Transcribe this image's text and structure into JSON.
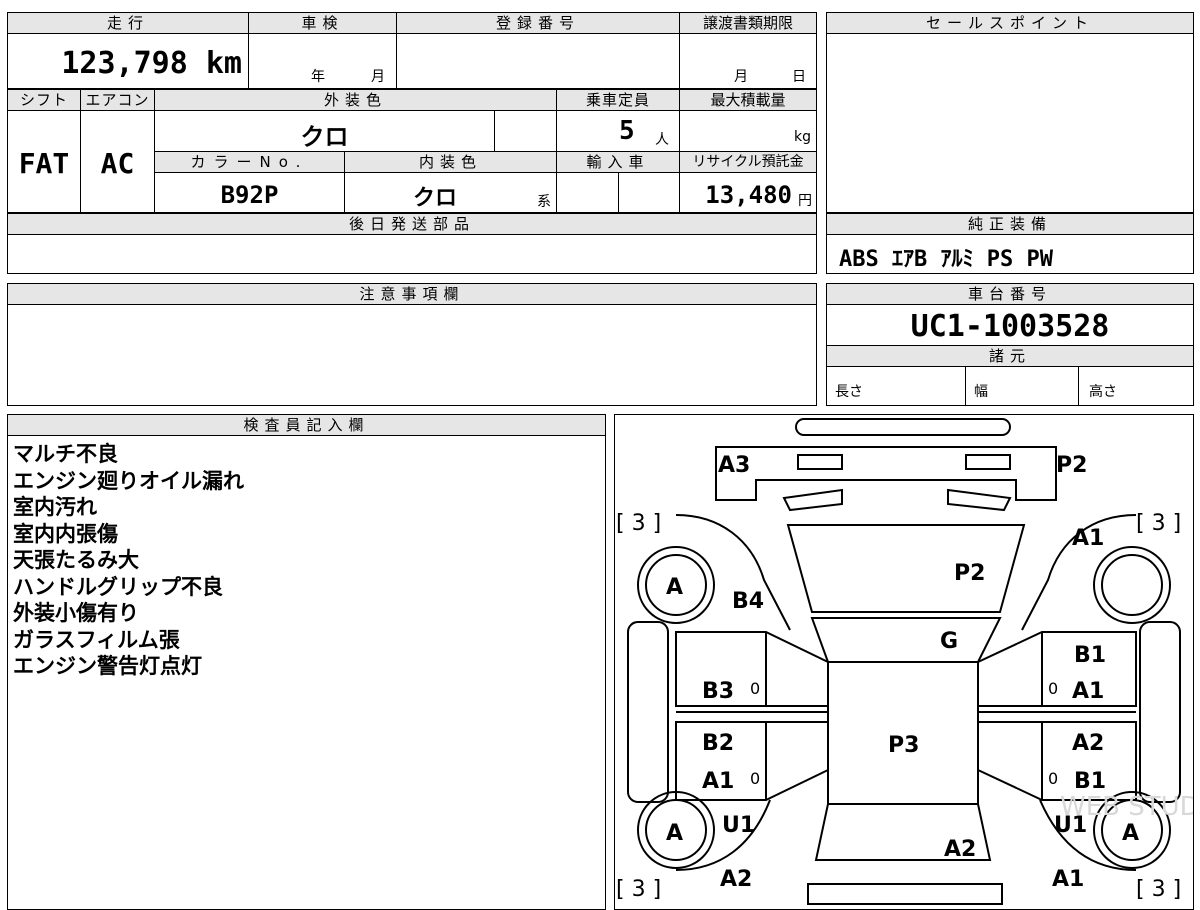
{
  "top": {
    "mileage_label": "走行",
    "mileage_value": "123,798 km",
    "inspection_label": "車検",
    "inspection_year": "年",
    "inspection_month": "月",
    "registration_label": "登録番号",
    "registration_value": "",
    "transfer_label": "譲渡書類期限",
    "transfer_month": "月",
    "transfer_day": "日",
    "shift_label": "シフト",
    "shift_value": "FAT",
    "ac_label": "エアコン",
    "ac_value": "AC",
    "exterior_label": "外装色",
    "exterior_value": "クロ",
    "capacity_label": "乗車定員",
    "capacity_value": "5",
    "capacity_unit": "人",
    "load_label": "最大積載量",
    "load_unit": "kg",
    "color_no_label": "カラーNo.",
    "color_no_value": "B92P",
    "interior_label": "内装色",
    "interior_value": "クロ",
    "interior_suffix": "系",
    "import_label": "輸入車",
    "recycle_label": "リサイクル預託金",
    "recycle_value": "13,480",
    "recycle_unit": "円",
    "later_parts_label": "後日発送部品",
    "later_parts_value": ""
  },
  "right": {
    "sales_point_label": "セールスポイント",
    "sales_point_value": "",
    "equipment_label": "純正装備",
    "equipment_value": "ABS ｴｱB ｱﾙﾐ PS PW",
    "chassis_label": "車台番号",
    "chassis_value": "UC1-1003528",
    "specs_label": "諸元",
    "length_label": "長さ",
    "width_label": "幅",
    "height_label": "高さ"
  },
  "notes": {
    "label": "注意事項欄",
    "value": ""
  },
  "inspector": {
    "label": "検査員記入欄",
    "remarks": [
      "マルチ不良",
      "エンジン廻りオイル漏れ",
      "室内汚れ",
      "室内内張傷",
      "天張たるみ大",
      "ハンドルグリップ不良",
      "外装小傷有り",
      "ガラスフィルム張",
      "エンジン警告灯点灯"
    ]
  },
  "diagram": {
    "marks": {
      "rear_left": "A3",
      "rear_right": "P2",
      "tire_count_tl": "[ 3 ]",
      "tire_count_tr": "[ 3 ]",
      "tire_count_bl": "[ 3 ]",
      "tire_count_br": "[ 3 ]",
      "right_rear_quarter": "A1",
      "wheel_tl": "A",
      "left_rear_quarter": "B4",
      "roof_glass_rear": "P2",
      "rear_glass": "G",
      "right_rear_door_1": "B1",
      "right_rear_door_2": "A1",
      "left_rear_door": "B3",
      "roof": "P3",
      "left_front_door_1": "B2",
      "left_front_door_2": "A1",
      "right_front_door_1": "A2",
      "right_front_door_2": "B1",
      "left_fender": "U1",
      "right_fender": "U1",
      "wheel_bl": "A",
      "wheel_br": "A",
      "hood": "A2",
      "left_front_corner": "A2",
      "right_front_corner": "A1",
      "glass_mark": "0",
      "watermark": "WEB STUDIO"
    }
  }
}
